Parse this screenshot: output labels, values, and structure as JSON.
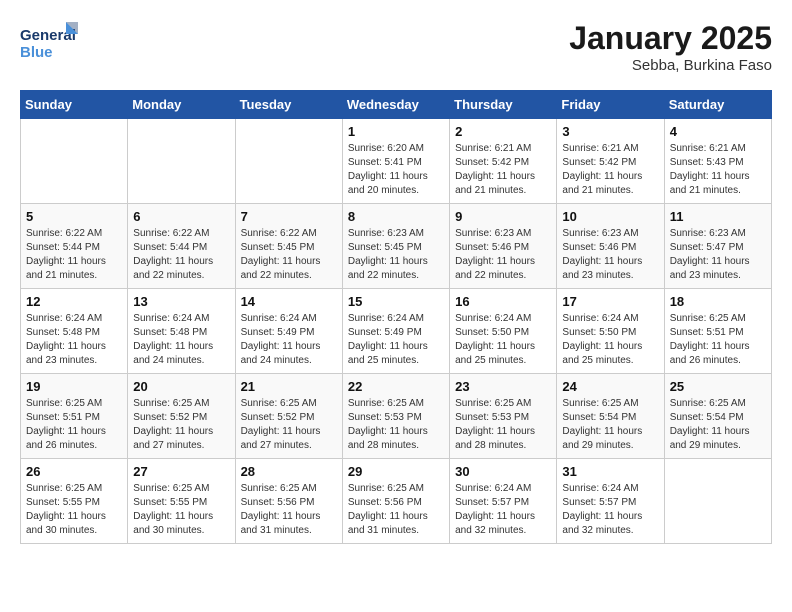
{
  "header": {
    "logo_line1": "General",
    "logo_line2": "Blue",
    "month_title": "January 2025",
    "location": "Sebba, Burkina Faso"
  },
  "weekdays": [
    "Sunday",
    "Monday",
    "Tuesday",
    "Wednesday",
    "Thursday",
    "Friday",
    "Saturday"
  ],
  "weeks": [
    [
      {
        "day": "",
        "info": ""
      },
      {
        "day": "",
        "info": ""
      },
      {
        "day": "",
        "info": ""
      },
      {
        "day": "1",
        "info": "Sunrise: 6:20 AM\nSunset: 5:41 PM\nDaylight: 11 hours and 20 minutes."
      },
      {
        "day": "2",
        "info": "Sunrise: 6:21 AM\nSunset: 5:42 PM\nDaylight: 11 hours and 21 minutes."
      },
      {
        "day": "3",
        "info": "Sunrise: 6:21 AM\nSunset: 5:42 PM\nDaylight: 11 hours and 21 minutes."
      },
      {
        "day": "4",
        "info": "Sunrise: 6:21 AM\nSunset: 5:43 PM\nDaylight: 11 hours and 21 minutes."
      }
    ],
    [
      {
        "day": "5",
        "info": "Sunrise: 6:22 AM\nSunset: 5:44 PM\nDaylight: 11 hours and 21 minutes."
      },
      {
        "day": "6",
        "info": "Sunrise: 6:22 AM\nSunset: 5:44 PM\nDaylight: 11 hours and 22 minutes."
      },
      {
        "day": "7",
        "info": "Sunrise: 6:22 AM\nSunset: 5:45 PM\nDaylight: 11 hours and 22 minutes."
      },
      {
        "day": "8",
        "info": "Sunrise: 6:23 AM\nSunset: 5:45 PM\nDaylight: 11 hours and 22 minutes."
      },
      {
        "day": "9",
        "info": "Sunrise: 6:23 AM\nSunset: 5:46 PM\nDaylight: 11 hours and 22 minutes."
      },
      {
        "day": "10",
        "info": "Sunrise: 6:23 AM\nSunset: 5:46 PM\nDaylight: 11 hours and 23 minutes."
      },
      {
        "day": "11",
        "info": "Sunrise: 6:23 AM\nSunset: 5:47 PM\nDaylight: 11 hours and 23 minutes."
      }
    ],
    [
      {
        "day": "12",
        "info": "Sunrise: 6:24 AM\nSunset: 5:48 PM\nDaylight: 11 hours and 23 minutes."
      },
      {
        "day": "13",
        "info": "Sunrise: 6:24 AM\nSunset: 5:48 PM\nDaylight: 11 hours and 24 minutes."
      },
      {
        "day": "14",
        "info": "Sunrise: 6:24 AM\nSunset: 5:49 PM\nDaylight: 11 hours and 24 minutes."
      },
      {
        "day": "15",
        "info": "Sunrise: 6:24 AM\nSunset: 5:49 PM\nDaylight: 11 hours and 25 minutes."
      },
      {
        "day": "16",
        "info": "Sunrise: 6:24 AM\nSunset: 5:50 PM\nDaylight: 11 hours and 25 minutes."
      },
      {
        "day": "17",
        "info": "Sunrise: 6:24 AM\nSunset: 5:50 PM\nDaylight: 11 hours and 25 minutes."
      },
      {
        "day": "18",
        "info": "Sunrise: 6:25 AM\nSunset: 5:51 PM\nDaylight: 11 hours and 26 minutes."
      }
    ],
    [
      {
        "day": "19",
        "info": "Sunrise: 6:25 AM\nSunset: 5:51 PM\nDaylight: 11 hours and 26 minutes."
      },
      {
        "day": "20",
        "info": "Sunrise: 6:25 AM\nSunset: 5:52 PM\nDaylight: 11 hours and 27 minutes."
      },
      {
        "day": "21",
        "info": "Sunrise: 6:25 AM\nSunset: 5:52 PM\nDaylight: 11 hours and 27 minutes."
      },
      {
        "day": "22",
        "info": "Sunrise: 6:25 AM\nSunset: 5:53 PM\nDaylight: 11 hours and 28 minutes."
      },
      {
        "day": "23",
        "info": "Sunrise: 6:25 AM\nSunset: 5:53 PM\nDaylight: 11 hours and 28 minutes."
      },
      {
        "day": "24",
        "info": "Sunrise: 6:25 AM\nSunset: 5:54 PM\nDaylight: 11 hours and 29 minutes."
      },
      {
        "day": "25",
        "info": "Sunrise: 6:25 AM\nSunset: 5:54 PM\nDaylight: 11 hours and 29 minutes."
      }
    ],
    [
      {
        "day": "26",
        "info": "Sunrise: 6:25 AM\nSunset: 5:55 PM\nDaylight: 11 hours and 30 minutes."
      },
      {
        "day": "27",
        "info": "Sunrise: 6:25 AM\nSunset: 5:55 PM\nDaylight: 11 hours and 30 minutes."
      },
      {
        "day": "28",
        "info": "Sunrise: 6:25 AM\nSunset: 5:56 PM\nDaylight: 11 hours and 31 minutes."
      },
      {
        "day": "29",
        "info": "Sunrise: 6:25 AM\nSunset: 5:56 PM\nDaylight: 11 hours and 31 minutes."
      },
      {
        "day": "30",
        "info": "Sunrise: 6:24 AM\nSunset: 5:57 PM\nDaylight: 11 hours and 32 minutes."
      },
      {
        "day": "31",
        "info": "Sunrise: 6:24 AM\nSunset: 5:57 PM\nDaylight: 11 hours and 32 minutes."
      },
      {
        "day": "",
        "info": ""
      }
    ]
  ]
}
